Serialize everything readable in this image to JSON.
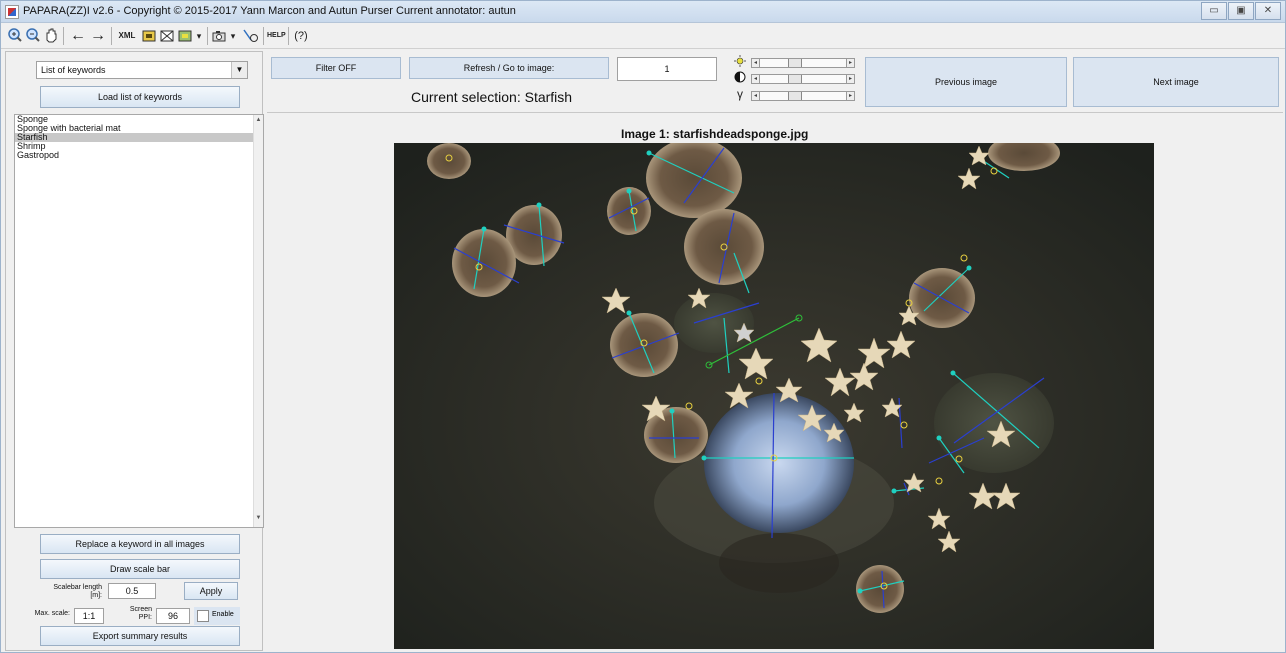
{
  "window": {
    "title": "PAPARA(ZZ)I v2.6 - Copyright © 2015-2017 Yann Marcon and Autun Purser",
    "annotator": "Current annotator: autun"
  },
  "toolbar": {
    "icons": [
      "zoom-in-icon",
      "zoom-out-icon",
      "pan-icon",
      "arrow-left-icon",
      "arrow-right-icon",
      "xml-icon",
      "grid-icon",
      "frame-icon",
      "image-icon",
      "camera-icon",
      "marker-icon",
      "help-icon",
      "question-icon"
    ],
    "xml_label": "XML",
    "help_label": "HELP",
    "question_label": "(?)"
  },
  "left": {
    "dropdown_value": "List of keywords",
    "load_button": "Load list of keywords",
    "keywords": [
      "Sponge",
      "Sponge with bacterial mat",
      "Starfish",
      "Shrimp",
      "Gastropod"
    ],
    "selected_index": 2,
    "replace_button": "Replace a keyword in all images",
    "scale_bar_button": "Draw scale bar",
    "scalebar_label_1": "Scalebar length",
    "scalebar_label_2": "[m]:",
    "scalebar_value": "0.5",
    "apply_button": "Apply",
    "max_scale_label": "Max. scale:",
    "max_scale_value": "1:1",
    "screen_label_1": "Screen",
    "screen_label_2": "PPI:",
    "ppi_value": "96",
    "enable_label": "Enable",
    "export_button": "Export summary results"
  },
  "top": {
    "filter_button": "Filter OFF",
    "refresh_button": "Refresh / Go to image:",
    "image_number": "1",
    "current_selection": "Current selection: Starfish",
    "prev_button": "Previous image",
    "next_button": "Next image",
    "slider_icons": [
      "brightness-icon",
      "contrast-icon",
      "gamma-icon"
    ]
  },
  "image": {
    "title": "Image 1: starfishdeadsponge.jpg"
  },
  "colors": {
    "titlebar": "#c9d9ec",
    "button": "#dbe5f1",
    "selected_row": "#c8c8c8",
    "annotation_cyan": "#1fd0c0",
    "annotation_blue": "#2a3fd0",
    "annotation_green": "#2fbe3a",
    "annotation_yellow": "#e8d040"
  }
}
